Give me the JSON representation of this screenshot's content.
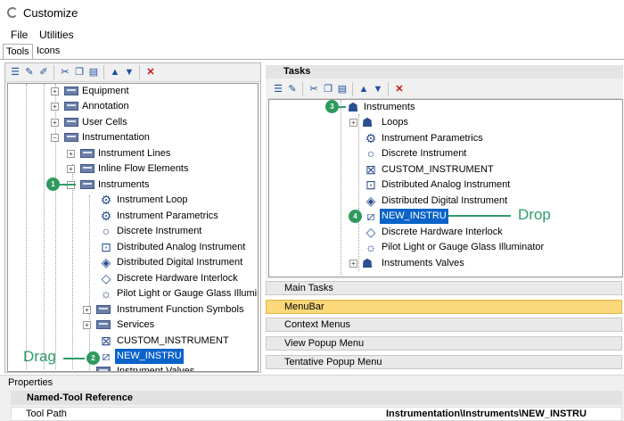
{
  "window": {
    "title": "Customize"
  },
  "menu": {
    "file": "File",
    "utilities": "Utilities"
  },
  "tabs": {
    "tools": "Tools",
    "icons": "Icons"
  },
  "left_tree": {
    "items": [
      {
        "label": "Equipment",
        "kind": "folder",
        "expander": "+"
      },
      {
        "label": "Annotation",
        "kind": "folder",
        "expander": "+"
      },
      {
        "label": "User Cells",
        "kind": "folder",
        "expander": "+"
      },
      {
        "label": "Instrumentation",
        "kind": "folder",
        "expander": "−"
      },
      {
        "label": "Instrument Lines",
        "kind": "folder",
        "expander": "+"
      },
      {
        "label": "Inline Flow Elements",
        "kind": "folder",
        "expander": "+"
      },
      {
        "label": "Instruments",
        "kind": "folder",
        "expander": "−"
      },
      {
        "label": "Instrument Loop",
        "kind": "tool",
        "icon": "instrument-loop-icon"
      },
      {
        "label": "Instrument Parametrics",
        "kind": "tool",
        "icon": "instrument-parametrics-icon"
      },
      {
        "label": "Discrete Instrument",
        "kind": "tool",
        "icon": "circle-icon"
      },
      {
        "label": "Distributed Analog Instrument",
        "kind": "tool",
        "icon": "square-circle-icon"
      },
      {
        "label": "Distributed Digital Instrument",
        "kind": "tool",
        "icon": "square-circle-icon"
      },
      {
        "label": "Discrete Hardware Interlock",
        "kind": "tool",
        "icon": "diamond-icon"
      },
      {
        "label": "Pilot Light or Gauge Glass Illuminator",
        "kind": "tool",
        "icon": "pilot-light-icon"
      },
      {
        "label": "Instrument Function Symbols",
        "kind": "folder",
        "expander": "+"
      },
      {
        "label": "Services",
        "kind": "folder",
        "expander": "+"
      },
      {
        "label": "CUSTOM_INSTRUMENT",
        "kind": "tool",
        "icon": "x-box-icon"
      },
      {
        "label": "NEW_INSTRU",
        "kind": "tool",
        "icon": "slash-box-icon",
        "selected": true
      },
      {
        "label": "Instrument Valves",
        "kind": "folder"
      }
    ]
  },
  "tasks": {
    "header": "Tasks",
    "items": [
      {
        "label": "Instruments",
        "kind": "root"
      },
      {
        "label": "Loops",
        "kind": "folder"
      },
      {
        "label": "Instrument Parametrics",
        "kind": "tool"
      },
      {
        "label": "Discrete Instrument",
        "kind": "tool"
      },
      {
        "label": "CUSTOM_INSTRUMENT",
        "kind": "tool"
      },
      {
        "label": "Distributed Analog Instrument",
        "kind": "tool"
      },
      {
        "label": "Distributed Digital Instrument",
        "kind": "tool"
      },
      {
        "label": "NEW_INSTRU",
        "kind": "tool",
        "selected": true
      },
      {
        "label": "Discrete Hardware Interlock",
        "kind": "tool"
      },
      {
        "label": "Pilot Light or Gauge Glass Illuminator",
        "kind": "tool"
      },
      {
        "label": "Instruments Valves",
        "kind": "folder"
      }
    ]
  },
  "sections": [
    "Main Tasks",
    "MenuBar",
    "Context Menus",
    "View Popup Menu",
    "Tentative Popup Menu"
  ],
  "active_section": "MenuBar",
  "annotations": {
    "drag": "Drag",
    "drop": "Drop",
    "badge1": "1",
    "badge2": "2",
    "badge3": "3",
    "badge4": "4"
  },
  "properties": {
    "title": "Properties",
    "group": "Named-Tool Reference",
    "row_name": "Tool Path",
    "row_value": "Instrumentation\\Instruments\\NEW_INSTRU"
  },
  "colors": {
    "accent": "#2f9b69",
    "selection": "#0a63c9",
    "active_bar": "#fbd87a"
  }
}
